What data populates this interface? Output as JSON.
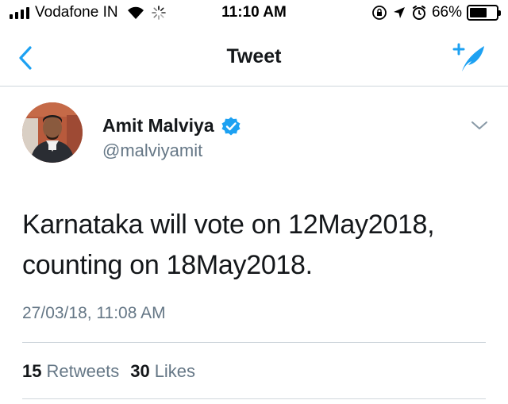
{
  "status_bar": {
    "carrier": "Vodafone IN",
    "time": "11:10 AM",
    "battery": "66%",
    "battery_level": 0.66,
    "icons": [
      "signal-icon",
      "wifi-icon",
      "activity-spinner-icon",
      "orientation-lock-icon",
      "location-icon",
      "alarm-icon",
      "battery-icon"
    ]
  },
  "nav": {
    "title": "Tweet",
    "back_icon": "chevron-left-icon",
    "compose_icon": "compose-tweet-icon",
    "accent": "#1da1f2"
  },
  "tweet": {
    "author_name": "Amit Malviya",
    "author_handle": "@malviyamit",
    "verified": true,
    "text_line1": "Karnataka will vote on 12May2018,",
    "text_line2": "counting on 18May2018.",
    "timestamp": "27/03/18, 11:08 AM",
    "retweets_count": "15",
    "retweets_label": "Retweets",
    "likes_count": "30",
    "likes_label": "Likes"
  }
}
